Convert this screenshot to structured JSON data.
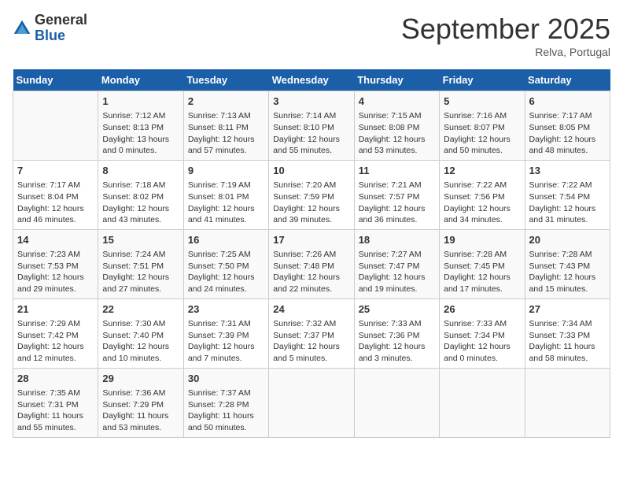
{
  "header": {
    "logo_general": "General",
    "logo_blue": "Blue",
    "month_title": "September 2025",
    "location": "Relva, Portugal"
  },
  "days_of_week": [
    "Sunday",
    "Monday",
    "Tuesday",
    "Wednesday",
    "Thursday",
    "Friday",
    "Saturday"
  ],
  "weeks": [
    [
      {
        "day": "",
        "info": ""
      },
      {
        "day": "1",
        "info": "Sunrise: 7:12 AM\nSunset: 8:13 PM\nDaylight: 13 hours\nand 0 minutes."
      },
      {
        "day": "2",
        "info": "Sunrise: 7:13 AM\nSunset: 8:11 PM\nDaylight: 12 hours\nand 57 minutes."
      },
      {
        "day": "3",
        "info": "Sunrise: 7:14 AM\nSunset: 8:10 PM\nDaylight: 12 hours\nand 55 minutes."
      },
      {
        "day": "4",
        "info": "Sunrise: 7:15 AM\nSunset: 8:08 PM\nDaylight: 12 hours\nand 53 minutes."
      },
      {
        "day": "5",
        "info": "Sunrise: 7:16 AM\nSunset: 8:07 PM\nDaylight: 12 hours\nand 50 minutes."
      },
      {
        "day": "6",
        "info": "Sunrise: 7:17 AM\nSunset: 8:05 PM\nDaylight: 12 hours\nand 48 minutes."
      }
    ],
    [
      {
        "day": "7",
        "info": "Sunrise: 7:17 AM\nSunset: 8:04 PM\nDaylight: 12 hours\nand 46 minutes."
      },
      {
        "day": "8",
        "info": "Sunrise: 7:18 AM\nSunset: 8:02 PM\nDaylight: 12 hours\nand 43 minutes."
      },
      {
        "day": "9",
        "info": "Sunrise: 7:19 AM\nSunset: 8:01 PM\nDaylight: 12 hours\nand 41 minutes."
      },
      {
        "day": "10",
        "info": "Sunrise: 7:20 AM\nSunset: 7:59 PM\nDaylight: 12 hours\nand 39 minutes."
      },
      {
        "day": "11",
        "info": "Sunrise: 7:21 AM\nSunset: 7:57 PM\nDaylight: 12 hours\nand 36 minutes."
      },
      {
        "day": "12",
        "info": "Sunrise: 7:22 AM\nSunset: 7:56 PM\nDaylight: 12 hours\nand 34 minutes."
      },
      {
        "day": "13",
        "info": "Sunrise: 7:22 AM\nSunset: 7:54 PM\nDaylight: 12 hours\nand 31 minutes."
      }
    ],
    [
      {
        "day": "14",
        "info": "Sunrise: 7:23 AM\nSunset: 7:53 PM\nDaylight: 12 hours\nand 29 minutes."
      },
      {
        "day": "15",
        "info": "Sunrise: 7:24 AM\nSunset: 7:51 PM\nDaylight: 12 hours\nand 27 minutes."
      },
      {
        "day": "16",
        "info": "Sunrise: 7:25 AM\nSunset: 7:50 PM\nDaylight: 12 hours\nand 24 minutes."
      },
      {
        "day": "17",
        "info": "Sunrise: 7:26 AM\nSunset: 7:48 PM\nDaylight: 12 hours\nand 22 minutes."
      },
      {
        "day": "18",
        "info": "Sunrise: 7:27 AM\nSunset: 7:47 PM\nDaylight: 12 hours\nand 19 minutes."
      },
      {
        "day": "19",
        "info": "Sunrise: 7:28 AM\nSunset: 7:45 PM\nDaylight: 12 hours\nand 17 minutes."
      },
      {
        "day": "20",
        "info": "Sunrise: 7:28 AM\nSunset: 7:43 PM\nDaylight: 12 hours\nand 15 minutes."
      }
    ],
    [
      {
        "day": "21",
        "info": "Sunrise: 7:29 AM\nSunset: 7:42 PM\nDaylight: 12 hours\nand 12 minutes."
      },
      {
        "day": "22",
        "info": "Sunrise: 7:30 AM\nSunset: 7:40 PM\nDaylight: 12 hours\nand 10 minutes."
      },
      {
        "day": "23",
        "info": "Sunrise: 7:31 AM\nSunset: 7:39 PM\nDaylight: 12 hours\nand 7 minutes."
      },
      {
        "day": "24",
        "info": "Sunrise: 7:32 AM\nSunset: 7:37 PM\nDaylight: 12 hours\nand 5 minutes."
      },
      {
        "day": "25",
        "info": "Sunrise: 7:33 AM\nSunset: 7:36 PM\nDaylight: 12 hours\nand 3 minutes."
      },
      {
        "day": "26",
        "info": "Sunrise: 7:33 AM\nSunset: 7:34 PM\nDaylight: 12 hours\nand 0 minutes."
      },
      {
        "day": "27",
        "info": "Sunrise: 7:34 AM\nSunset: 7:33 PM\nDaylight: 11 hours\nand 58 minutes."
      }
    ],
    [
      {
        "day": "28",
        "info": "Sunrise: 7:35 AM\nSunset: 7:31 PM\nDaylight: 11 hours\nand 55 minutes."
      },
      {
        "day": "29",
        "info": "Sunrise: 7:36 AM\nSunset: 7:29 PM\nDaylight: 11 hours\nand 53 minutes."
      },
      {
        "day": "30",
        "info": "Sunrise: 7:37 AM\nSunset: 7:28 PM\nDaylight: 11 hours\nand 50 minutes."
      },
      {
        "day": "",
        "info": ""
      },
      {
        "day": "",
        "info": ""
      },
      {
        "day": "",
        "info": ""
      },
      {
        "day": "",
        "info": ""
      }
    ]
  ]
}
